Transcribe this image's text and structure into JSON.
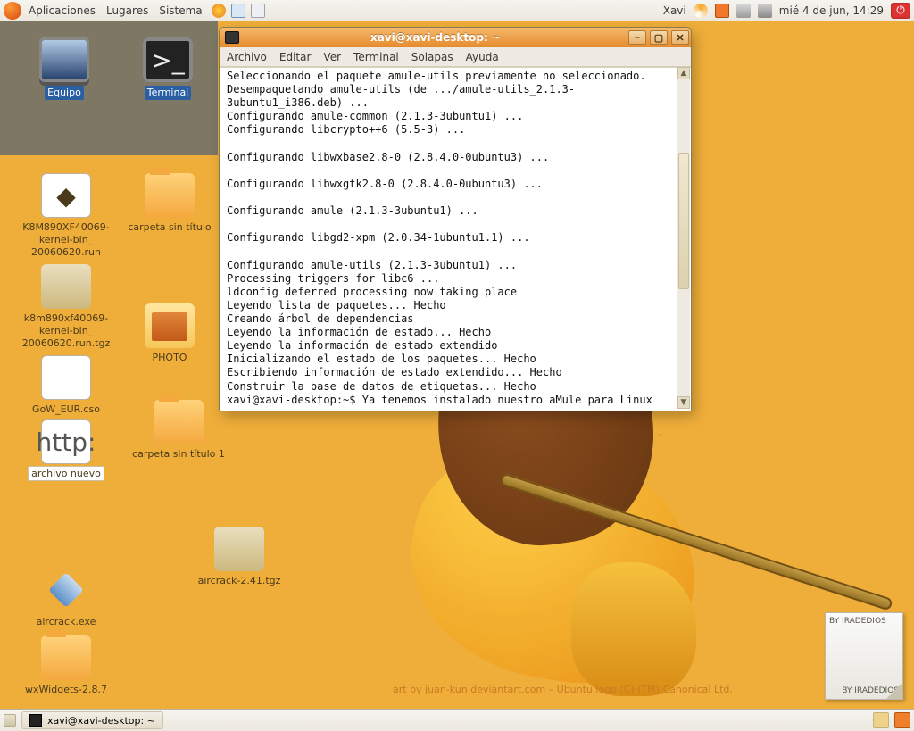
{
  "panel": {
    "menus": [
      "Aplicaciones",
      "Lugares",
      "Sistema"
    ],
    "user": "Xavi",
    "clock": "mié  4 de jun, 14:29"
  },
  "taskbar": {
    "task1": "xavi@xavi-desktop: ~"
  },
  "wallpaper_credit": "art by juan-kun.deviantart.com – Ubuntu logo (C) (TM) Canonical Ltd.",
  "sticky": {
    "top": "BY IRADEDIOS",
    "bottom": "BY IRADEDIOS"
  },
  "icons": {
    "equipo": "Equipo",
    "terminal": "Terminal",
    "run1a": "K8M890XF40069-",
    "run1b": "kernel-bin_",
    "run1c": "20060620.run",
    "carpeta1": "carpeta sin título",
    "tgz1a": "k8m890xf40069-",
    "tgz1b": "kernel-bin_",
    "tgz1c": "20060620.run.tgz",
    "photo": "PHOTO",
    "gow": "GoW_EUR.cso",
    "carpeta2": "carpeta sin título 1",
    "archivo": "archivo nuevo",
    "http_badge": "http:",
    "aircrack_tgz": "aircrack-2.41.tgz",
    "aircrack_exe": "aircrack.exe",
    "wxwidgets": "wxWidgets-2.8.7"
  },
  "terminal": {
    "title": "xavi@xavi-desktop: ~",
    "menu": {
      "archivo": "Archivo",
      "editar": "Editar",
      "ver": "Ver",
      "terminal": "Terminal",
      "solapas": "Solapas",
      "ayuda": "Ayuda"
    },
    "body": "Seleccionando el paquete amule-utils previamente no seleccionado.\nDesempaquetando amule-utils (de .../amule-utils_2.1.3-3ubuntu1_i386.deb) ...\nConfigurando amule-common (2.1.3-3ubuntu1) ...\nConfigurando libcrypto++6 (5.5-3) ...\n\nConfigurando libwxbase2.8-0 (2.8.4.0-0ubuntu3) ...\n\nConfigurando libwxgtk2.8-0 (2.8.4.0-0ubuntu3) ...\n\nConfigurando amule (2.1.3-3ubuntu1) ...\n\nConfigurando libgd2-xpm (2.0.34-1ubuntu1.1) ...\n\nConfigurando amule-utils (2.1.3-3ubuntu1) ...\nProcessing triggers for libc6 ...\nldconfig deferred processing now taking place\nLeyendo lista de paquetes... Hecho\nCreando árbol de dependencias\nLeyendo la información de estado... Hecho\nLeyendo la información de estado extendido\nInicializando el estado de los paquetes... Hecho\nEscribiendo información de estado extendido... Hecho\nConstruir la base de datos de etiquetas... Hecho",
    "prompt": "xavi@xavi-desktop:~$ ",
    "cmd": "Ya tenemos instalado nuestro aMule para Linux"
  }
}
